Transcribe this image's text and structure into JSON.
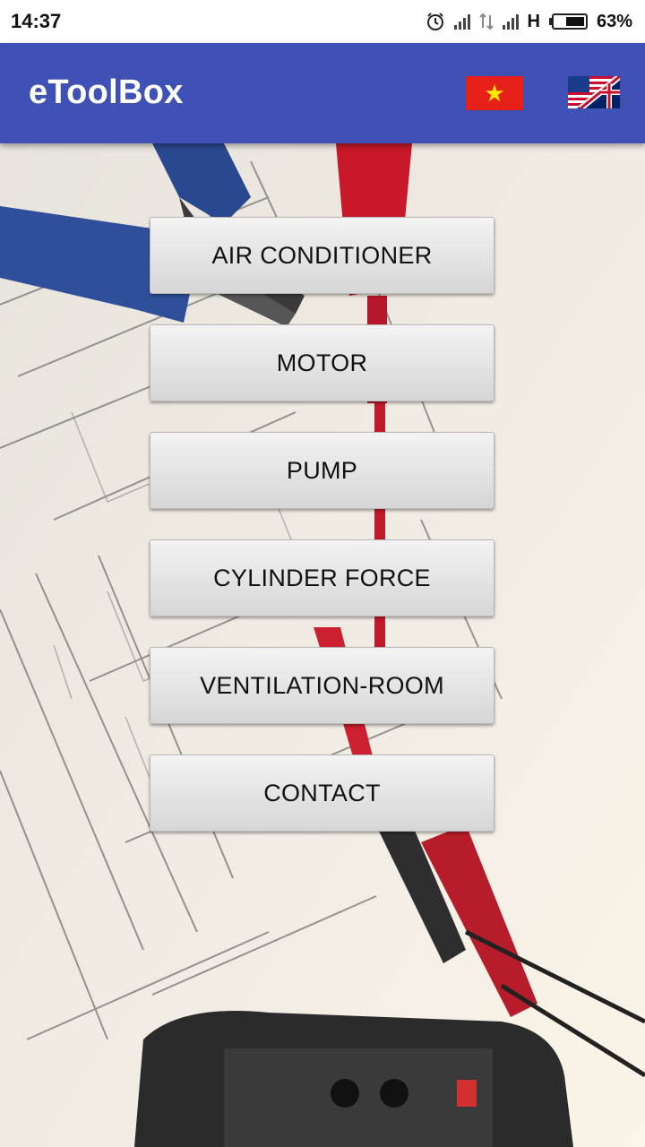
{
  "status_bar": {
    "time": "14:37",
    "network": "H",
    "battery": "63%",
    "battery_level": 0.63,
    "icons": [
      "alarm-icon",
      "signal-icon",
      "data-arrows-icon",
      "signal-icon",
      "battery-icon"
    ]
  },
  "app_bar": {
    "title": "eToolBox",
    "flags": [
      "vietnam-flag-icon",
      "uk-flag-icon"
    ],
    "accent_color": "#3f51b5"
  },
  "menu": {
    "items": [
      {
        "label": "AIR CONDITIONER"
      },
      {
        "label": "MOTOR"
      },
      {
        "label": "PUMP"
      },
      {
        "label": "CYLINDER FORCE"
      },
      {
        "label": "VENTILATION-ROOM"
      },
      {
        "label": "CONTACT"
      }
    ]
  }
}
